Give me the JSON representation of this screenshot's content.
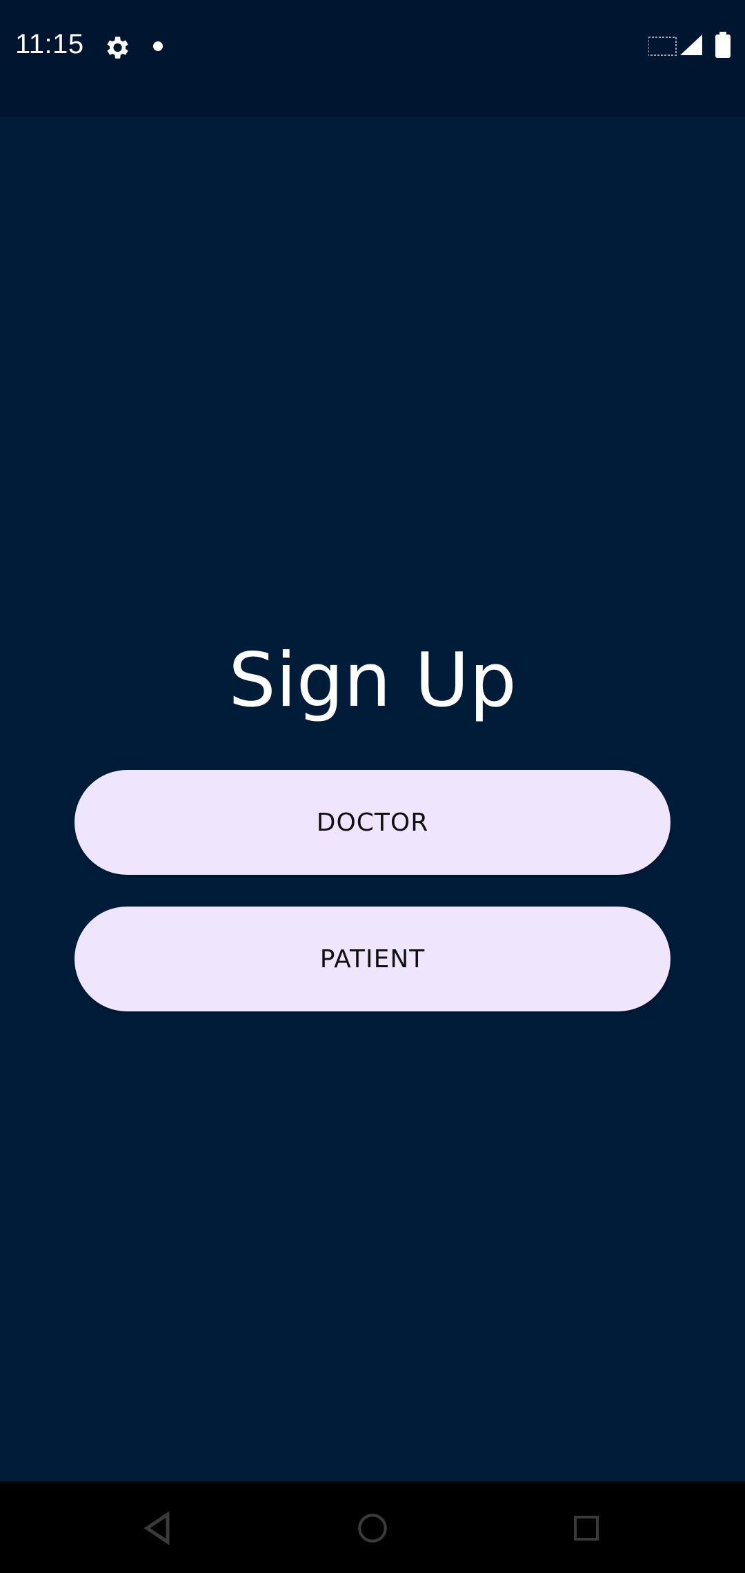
{
  "status_bar": {
    "time": "11:15",
    "icons": [
      "settings-gear-icon",
      "notification-dot-icon",
      "signal-icon",
      "battery-icon"
    ]
  },
  "main": {
    "title": "Sign Up",
    "buttons": [
      {
        "label": "DOCTOR"
      },
      {
        "label": "PATIENT"
      }
    ]
  },
  "nav_bar": {
    "icons": [
      "back-icon",
      "home-icon",
      "recents-icon"
    ]
  },
  "colors": {
    "background": "#001c38",
    "status_bar": "#001530",
    "button_fill": "#efe5fd",
    "button_text": "#111111",
    "title_text": "#ffffff",
    "nav_bar": "#000000"
  }
}
